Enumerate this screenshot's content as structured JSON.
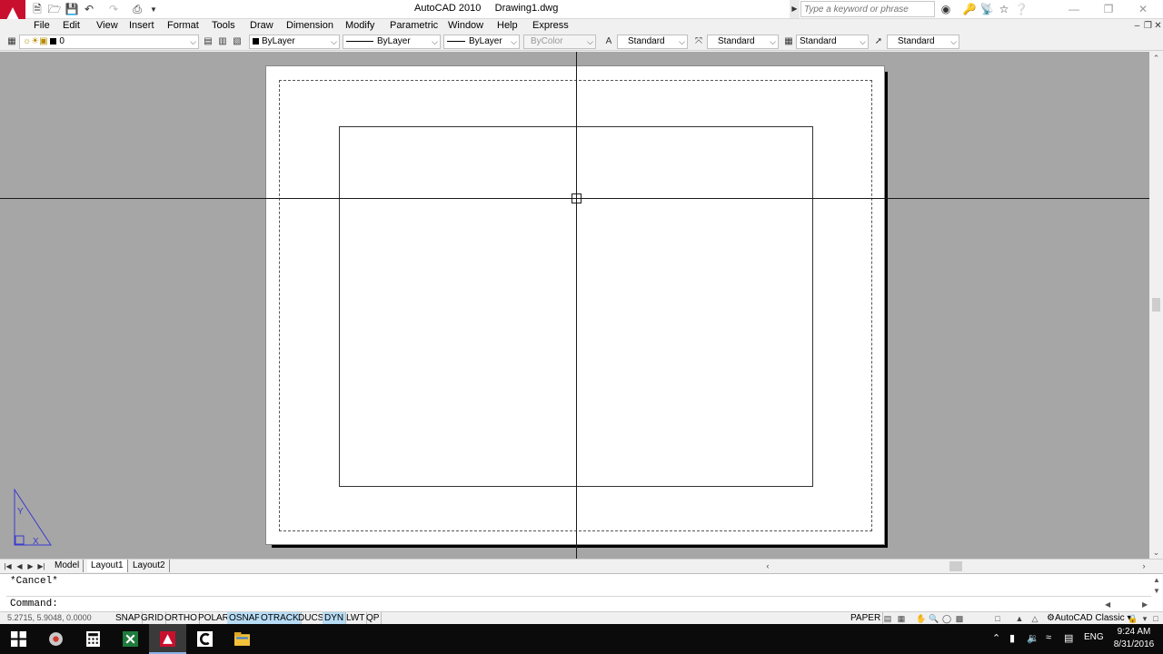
{
  "window": {
    "app_title": "AutoCAD 2010",
    "doc_title": "Drawing1.dwg",
    "search_placeholder": "Type a keyword or phrase"
  },
  "qat": {
    "icons": [
      "new-icon",
      "open-icon",
      "save-icon",
      "undo-icon",
      "redo-icon",
      "plot-icon"
    ]
  },
  "menu": {
    "items": [
      "File",
      "Edit",
      "View",
      "Insert",
      "Format",
      "Tools",
      "Draw",
      "Dimension",
      "Modify",
      "Parametric",
      "Window",
      "Help",
      "Express"
    ]
  },
  "toolbar": {
    "layer": "0",
    "color": "ByLayer",
    "linetype": "ByLayer",
    "lineweight": "ByLayer",
    "plotstyle": "ByColor",
    "text_style": "Standard",
    "dim_style": "Standard",
    "table_style": "Standard",
    "mleader_style": "Standard"
  },
  "layout_tabs": [
    "Model",
    "Layout1",
    "Layout2"
  ],
  "command": {
    "history": "*Cancel*",
    "prompt": "Command:"
  },
  "status": {
    "coords": "5.2715, 5.9048, 0.0000",
    "toggles": [
      {
        "label": "SNAP",
        "on": false
      },
      {
        "label": "GRID",
        "on": false
      },
      {
        "label": "ORTHO",
        "on": false
      },
      {
        "label": "POLAR",
        "on": false
      },
      {
        "label": "OSNAP",
        "on": true
      },
      {
        "label": "OTRACK",
        "on": true
      },
      {
        "label": "DUCS",
        "on": false
      },
      {
        "label": "DYN",
        "on": true
      },
      {
        "label": "LWT",
        "on": false
      },
      {
        "label": "QP",
        "on": false
      }
    ],
    "paper_label": "PAPER",
    "workspace": "AutoCAD Classic"
  },
  "ucs": {
    "y_label": "Y",
    "x_label": "X"
  },
  "taskbar": {
    "language": "ENG",
    "time": "9:24 AM",
    "date": "8/31/2016"
  },
  "colors": {
    "drawing_bg": "#a6a6a6",
    "paper": "#ffffff",
    "toggle_on": "#b7dcf5",
    "taskbar": "#0b0b0b",
    "acad_red": "#c8102e"
  }
}
